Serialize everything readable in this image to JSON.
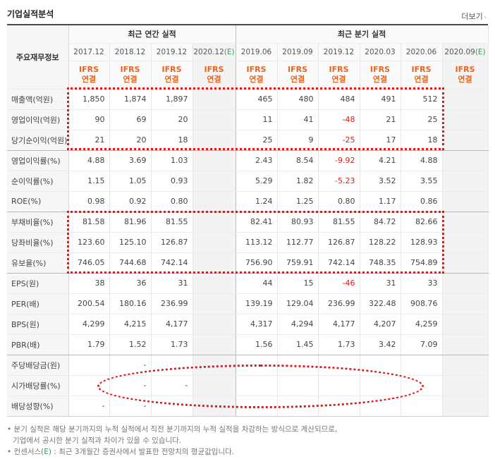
{
  "header": {
    "title": "기업실적분석",
    "more_label": "더보기",
    "more_arrow": "›"
  },
  "table": {
    "corner_label": "주요재무정보",
    "annual_group": "최근 연간 실적",
    "quarter_group": "최근 분기 실적",
    "periods": [
      "2017.12",
      "2018.12",
      "2019.12",
      "2020.12",
      "2019.06",
      "2019.09",
      "2019.12",
      "2020.03",
      "2020.06",
      "2020.09"
    ],
    "estimate_mark": "(E)",
    "ifrs": "IFRS",
    "consolidated": "연결",
    "rows": [
      {
        "label": "매출액(억원)",
        "values": [
          "1,850",
          "1,874",
          "1,897",
          "",
          "465",
          "480",
          "484",
          "491",
          "512",
          ""
        ]
      },
      {
        "label": "영업이익(억원)",
        "values": [
          "90",
          "69",
          "20",
          "",
          "11",
          "41",
          "-48",
          "21",
          "25",
          ""
        ]
      },
      {
        "label": "당기순이익(억원)",
        "values": [
          "21",
          "20",
          "18",
          "",
          "25",
          "9",
          "-25",
          "17",
          "18",
          ""
        ]
      },
      {
        "label": "영업이익률(%)",
        "values": [
          "4.88",
          "3.69",
          "1.03",
          "",
          "2.43",
          "8.54",
          "-9.92",
          "4.21",
          "4.88",
          ""
        ]
      },
      {
        "label": "순이익률(%)",
        "values": [
          "1.15",
          "1.05",
          "0.93",
          "",
          "5.29",
          "1.82",
          "-5.23",
          "3.52",
          "3.55",
          ""
        ]
      },
      {
        "label": "ROE(%)",
        "values": [
          "0.98",
          "0.92",
          "0.80",
          "",
          "1.24",
          "1.25",
          "0.80",
          "1.17",
          "0.86",
          ""
        ]
      },
      {
        "label": "부채비율(%)",
        "values": [
          "81.58",
          "81.96",
          "81.55",
          "",
          "82.41",
          "80.93",
          "81.55",
          "84.72",
          "82.66",
          ""
        ]
      },
      {
        "label": "당좌비율(%)",
        "values": [
          "123.60",
          "125.10",
          "126.87",
          "",
          "113.12",
          "112.77",
          "126.87",
          "128.22",
          "128.93",
          ""
        ]
      },
      {
        "label": "유보율(%)",
        "values": [
          "746.05",
          "744.68",
          "742.14",
          "",
          "756.90",
          "759.91",
          "742.14",
          "748.35",
          "754.89",
          ""
        ]
      },
      {
        "label": "EPS(원)",
        "values": [
          "38",
          "36",
          "31",
          "",
          "44",
          "15",
          "-46",
          "31",
          "33",
          ""
        ]
      },
      {
        "label": "PER(배)",
        "values": [
          "200.54",
          "180.16",
          "236.99",
          "",
          "139.19",
          "129.04",
          "236.99",
          "322.48",
          "908.76",
          ""
        ]
      },
      {
        "label": "BPS(원)",
        "values": [
          "4,299",
          "4,215",
          "4,177",
          "",
          "4,317",
          "4,294",
          "4,177",
          "4,207",
          "4,259",
          ""
        ]
      },
      {
        "label": "PBR(배)",
        "values": [
          "1.79",
          "1.52",
          "1.73",
          "",
          "1.56",
          "1.45",
          "1.73",
          "3.42",
          "7.09",
          ""
        ]
      },
      {
        "label": "주당배당금(원)",
        "values": [
          "",
          "-",
          "",
          "",
          "",
          "",
          "",
          "",
          "",
          ""
        ]
      },
      {
        "label": "시가배당률(%)",
        "values": [
          "",
          "-",
          "-",
          "",
          "",
          "",
          "",
          "",
          "",
          ""
        ]
      },
      {
        "label": "배당성향(%)",
        "values": [
          "-",
          "-",
          "",
          "",
          "",
          "",
          "",
          "",
          "",
          ""
        ]
      }
    ]
  },
  "notes": {
    "line1": "분기 실적은 해당 분기까지의 누적 실적에서 직전 분기까지의 누적 실적을 차감하는 방식으로 계산되므로,",
    "line2": "기업에서 공시한 분기 실적과 차이가 있을 수 있습니다.",
    "line3_a": "컨센서스",
    "line3_b": ": 최근 3개월간 증권사에서 발표한 전망치의 평균값입니다."
  },
  "colors": {
    "ifrs": "#e8641b",
    "negative": "#e01b1b",
    "estimate": "#2da54a",
    "highlight": "#e11818"
  }
}
